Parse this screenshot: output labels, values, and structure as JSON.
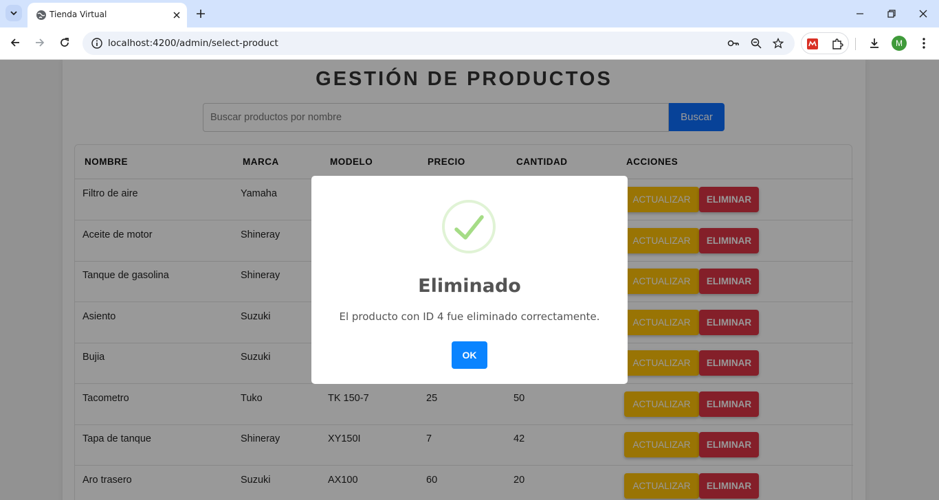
{
  "browser": {
    "tab_title": "Tienda Virtual",
    "url": "localhost:4200/admin/select-product",
    "avatar_letter": "M"
  },
  "page": {
    "title": "GESTIÓN DE PRODUCTOS",
    "search_placeholder": "Buscar productos por nombre",
    "search_button": "Buscar"
  },
  "table": {
    "headers": [
      "NOMBRE",
      "MARCA",
      "MODELO",
      "PRECIO",
      "CANTIDAD",
      "ACCIONES"
    ],
    "rows": [
      {
        "nombre": "Filtro de aire",
        "marca": "Yamaha",
        "modelo": "",
        "precio": "",
        "cantidad": ""
      },
      {
        "nombre": "Aceite de motor",
        "marca": "Shineray",
        "modelo": "",
        "precio": "",
        "cantidad": ""
      },
      {
        "nombre": "Tanque de gasolina",
        "marca": "Shineray",
        "modelo": "",
        "precio": "",
        "cantidad": ""
      },
      {
        "nombre": "Asiento",
        "marca": "Suzuki",
        "modelo": "",
        "precio": "",
        "cantidad": ""
      },
      {
        "nombre": "Bujia",
        "marca": "Suzuki",
        "modelo": "",
        "precio": "",
        "cantidad": ""
      },
      {
        "nombre": "Tacometro",
        "marca": "Tuko",
        "modelo": "TK 150-7",
        "precio": "25",
        "cantidad": "50"
      },
      {
        "nombre": "Tapa de tanque",
        "marca": "Shineray",
        "modelo": "XY150I",
        "precio": "7",
        "cantidad": "42"
      },
      {
        "nombre": "Aro trasero",
        "marca": "Suzuki",
        "modelo": "AX100",
        "precio": "60",
        "cantidad": "20"
      }
    ],
    "update_label": "ACTUALIZAR",
    "delete_label": "ELIMINAR"
  },
  "modal": {
    "title": "Eliminado",
    "message": "El producto con ID 4 fue eliminado correctamente.",
    "ok_label": "OK"
  },
  "colors": {
    "primary": "#0d6efd",
    "warning": "#ffc107",
    "danger": "#dc3545",
    "success_check": "#a5dc86",
    "modal_ok": "#0a84ff"
  }
}
